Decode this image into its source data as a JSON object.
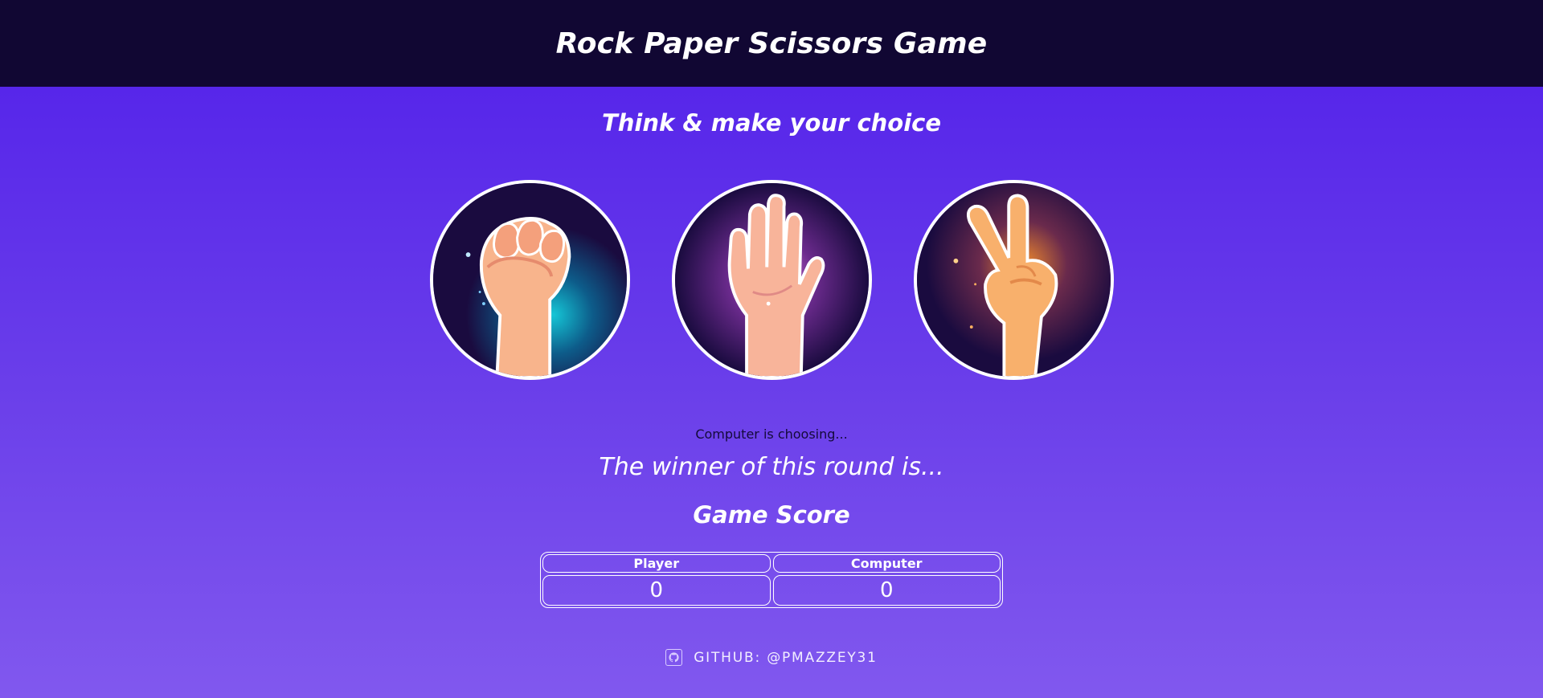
{
  "header": {
    "title": "Rock Paper Scissors Game"
  },
  "prompt": "Think & make your choice",
  "choices": [
    {
      "name": "rock",
      "icon": "fist-icon",
      "glow": "#15c6d6"
    },
    {
      "name": "paper",
      "icon": "open-hand-icon",
      "glow": "#c05ad8"
    },
    {
      "name": "scissors",
      "icon": "peace-sign-icon",
      "glow": "#f08a2c"
    }
  ],
  "status": "Computer is choosing...",
  "winner_text": "The winner of this round is...",
  "score": {
    "title": "Game Score",
    "headers": [
      "Player",
      "Computer"
    ],
    "values": [
      "0",
      "0"
    ]
  },
  "footer": {
    "icon": "github-icon",
    "text": "GITHUB: @PMAZZEY31"
  },
  "colors": {
    "header_bg": "#110733",
    "bg_top": "#511fea",
    "bg_bottom": "#8158ee",
    "card_bg": "#1a0b3f"
  }
}
